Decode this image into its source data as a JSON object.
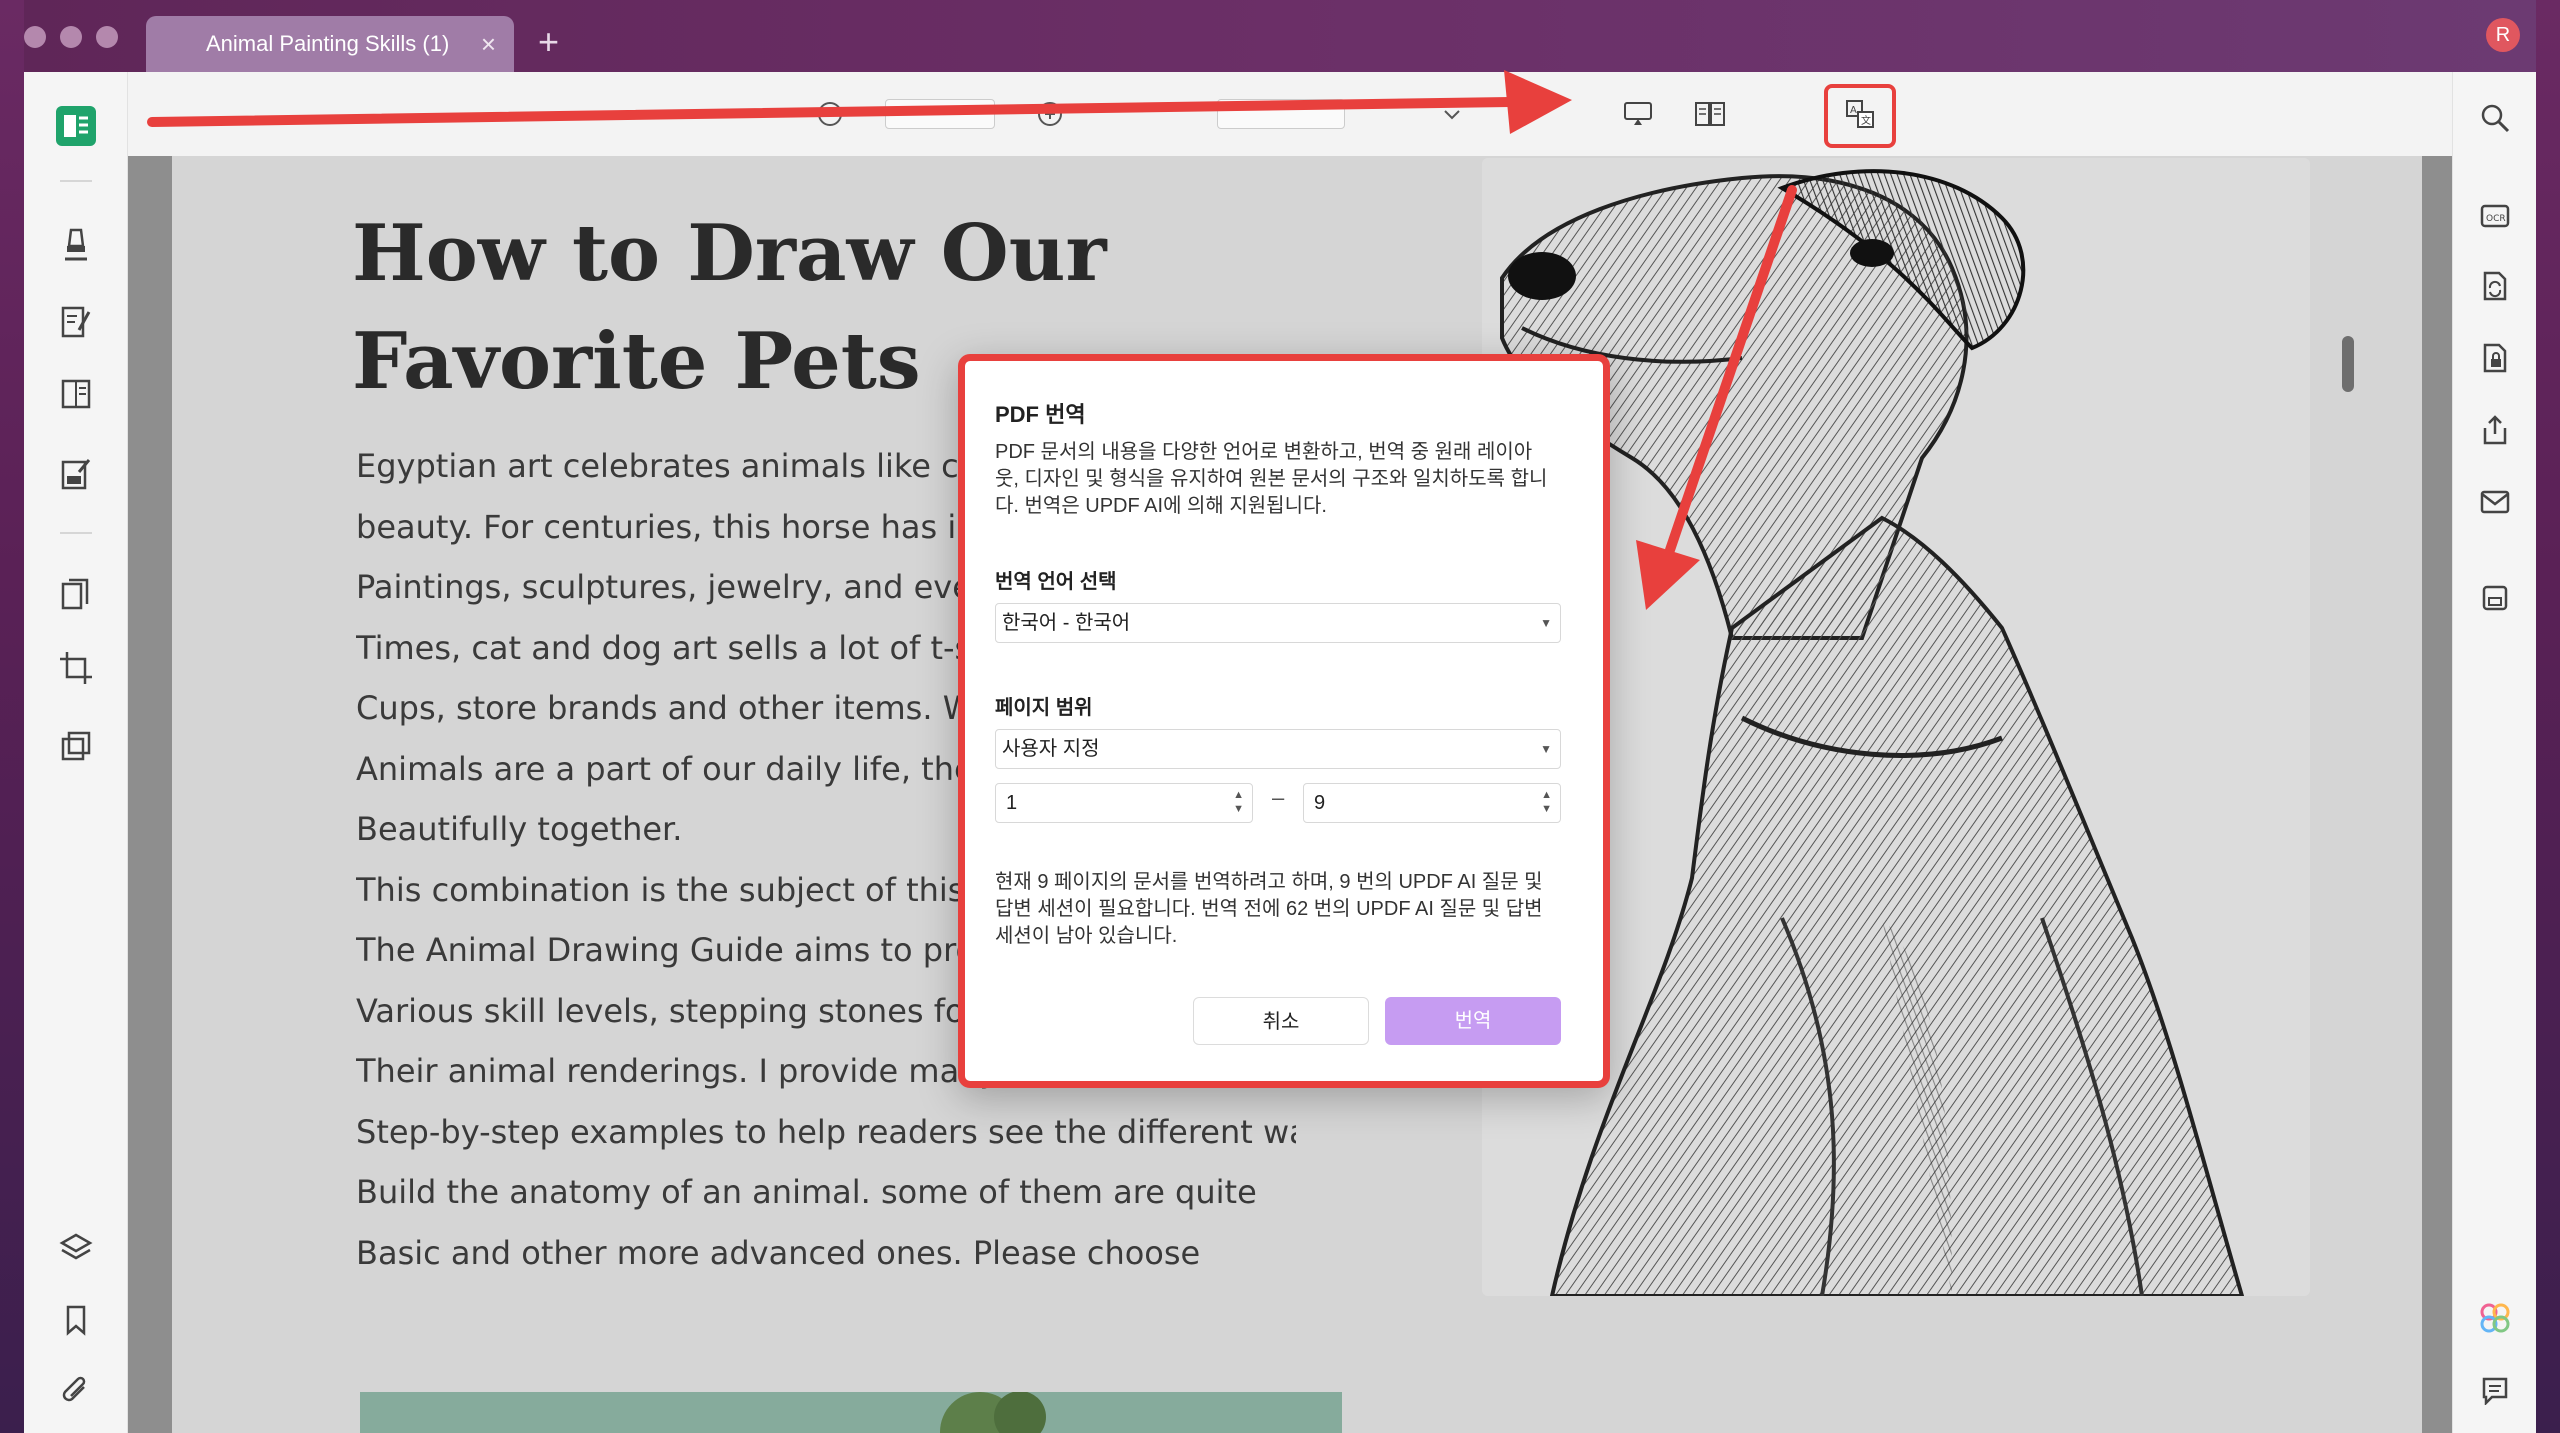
{
  "window": {
    "tab_title": "Animal Painting Skills (1)",
    "tab_close": "×",
    "new_tab": "+",
    "avatar_initial": "R"
  },
  "document": {
    "title_line1": "How to Draw Our",
    "title_line2": "Favorite Pets",
    "body_lines": [
      "Egyptian art celebrates animals like cats wi",
      "beauty. For centuries, this horse has inspire",
      "Paintings, sculptures, jewelry, and even arn",
      "Times, cat and dog art sells a lot of t-shirts,",
      "Cups, store brands and other items. Whethe",
      "Animals are a part of our daily life, the com",
      "Beautifully together.",
      "This combination is the subject of this book",
      "The Animal Drawing Guide aims to provide p",
      "Various skill levels, stepping stones for imp",
      "Their animal renderings. I provide many ske",
      "Step-by-step examples to help readers see the different ways",
      "Build the anatomy of an animal. some of them are quite",
      "Basic and other more advanced ones. Please choose"
    ]
  },
  "dialog": {
    "title": "PDF 번역",
    "description": "PDF 문서의 내용을 다양한 언어로 변환하고, 번역 중 원래 레이아웃, 디자인 및 형식을 유지하여 원본 문서의 구조와 일치하도록 합니다. 번역은 UPDF AI에 의해 지원됩니다.",
    "language_label": "번역 언어 선택",
    "language_value": "한국어 - 한국어",
    "page_range_label": "페이지 범위",
    "page_range_value": "사용자 지정",
    "range_from": "1",
    "range_to": "9",
    "range_dash": "–",
    "note": "현재 9 페이지의 문서를 번역하려고 하며, 9 번의 UPDF AI 질문 및 답변 세션이 필요합니다. 번역 전에 62 번의 UPDF AI 질문 및 답변 세션이 남아 있습니다.",
    "cancel_label": "취소",
    "translate_label": "번역"
  },
  "icons": {
    "left": [
      "reader-mode-icon",
      "highlighter-icon",
      "edit-pdf-icon",
      "organize-pages-icon",
      "fill-sign-icon",
      "page-tools-icon",
      "crop-icon",
      "compare-icon",
      "layers-icon",
      "bookmark-icon",
      "attachment-icon"
    ],
    "right": [
      "search-icon",
      "ocr-icon",
      "convert-icon",
      "protect-icon",
      "share-icon",
      "email-icon",
      "save-icon",
      "ai-assistant-icon",
      "comment-list-icon"
    ],
    "toolbar": [
      "slideshow-icon",
      "two-page-view-icon",
      "translate-icon"
    ]
  },
  "colors": {
    "accent_red": "#e8403d",
    "translate_button": "#c69cf2",
    "brand_green": "#1fa36b"
  }
}
